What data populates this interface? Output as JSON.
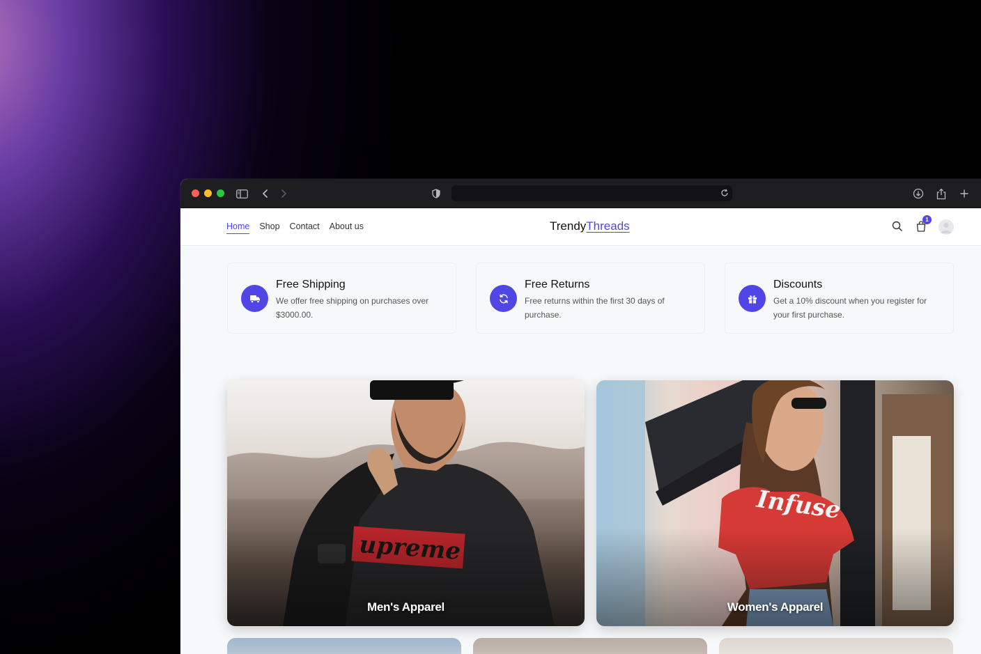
{
  "site": {
    "logo_main": "Trendy",
    "logo_accent": "Threads",
    "cart_count": "1"
  },
  "nav": {
    "items": [
      {
        "label": "Home",
        "active": true
      },
      {
        "label": "Shop",
        "active": false
      },
      {
        "label": "Contact",
        "active": false
      },
      {
        "label": "About us",
        "active": false
      }
    ]
  },
  "features": [
    {
      "title": "Free Shipping",
      "description": "We offer free shipping on purchases over $3000.00.",
      "icon": "truck-icon"
    },
    {
      "title": "Free Returns",
      "description": "Free returns within the first 30 days of purchase.",
      "icon": "refresh-icon"
    },
    {
      "title": "Discounts",
      "description": "Get a 10% discount when you register for your first purchase.",
      "icon": "gift-icon"
    }
  ],
  "categories": [
    {
      "label": "Men's Apparel",
      "shirt_text": "Supreme"
    },
    {
      "label": "Women's Apparel",
      "shirt_text": "Infuse"
    }
  ],
  "colors": {
    "accent": "#4f46e5",
    "browser_chrome": "#1e1e20"
  }
}
